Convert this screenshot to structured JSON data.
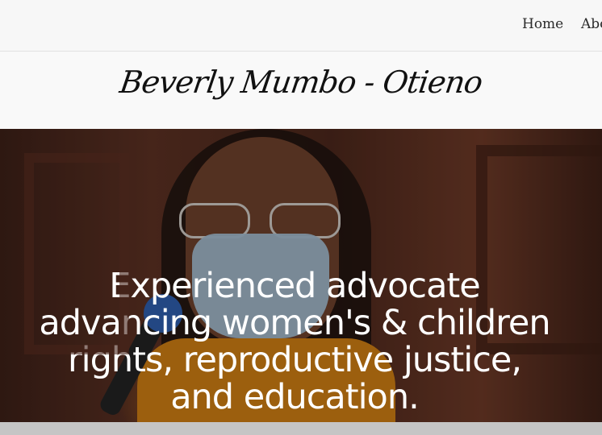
{
  "nav": {
    "items": [
      {
        "label": "Home"
      },
      {
        "label": "Abo"
      }
    ]
  },
  "brand": {
    "title": "Beverly Mumbo - Otieno"
  },
  "hero": {
    "headline": "Experienced advocate advancing women's & children rights, reproductive justice, and education."
  }
}
